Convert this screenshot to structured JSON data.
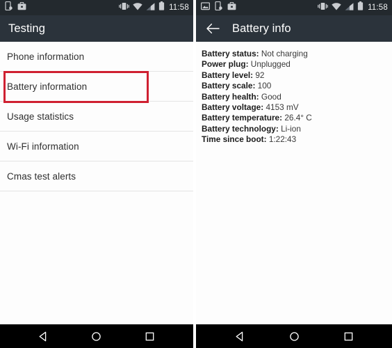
{
  "left_screen": {
    "statusbar": {
      "icons": [
        "usb-debug-icon",
        "work-briefcase-icon"
      ],
      "right_icons": [
        "vibrate-icon",
        "wifi-icon",
        "signal-icon",
        "battery-icon"
      ],
      "time": "11:58"
    },
    "toolbar": {
      "title": "Testing"
    },
    "list": {
      "items": [
        {
          "label": "Phone information"
        },
        {
          "label": "Battery information"
        },
        {
          "label": "Usage statistics"
        },
        {
          "label": "Wi-Fi information"
        },
        {
          "label": "Cmas test alerts"
        }
      ]
    },
    "highlight": {
      "target": "Battery information",
      "color": "#cf2031"
    }
  },
  "right_screen": {
    "statusbar": {
      "icons": [
        "screenshot-image-icon",
        "usb-debug-icon",
        "work-briefcase-icon"
      ],
      "right_icons": [
        "vibrate-icon",
        "wifi-icon",
        "signal-icon",
        "battery-icon"
      ],
      "time": "11:58"
    },
    "toolbar": {
      "back_icon": "arrow-left-icon",
      "title": "Battery info"
    },
    "info": {
      "rows": [
        {
          "label": "Battery status:",
          "value": "Not charging"
        },
        {
          "label": "Power plug:",
          "value": "Unplugged"
        },
        {
          "label": "Battery level:",
          "value": "92"
        },
        {
          "label": "Battery scale:",
          "value": "100"
        },
        {
          "label": "Battery health:",
          "value": "Good"
        },
        {
          "label": "Battery voltage:",
          "value": "4153 mV"
        },
        {
          "label": "Battery temperature:",
          "value": " 26.4° C"
        },
        {
          "label": "Battery technology:",
          "value": "Li-ion"
        },
        {
          "label": "Time since boot:",
          "value": "1:22:43"
        }
      ]
    }
  },
  "navbar": {
    "buttons": [
      {
        "name": "back-nav-button",
        "icon": "triangle-left-icon"
      },
      {
        "name": "home-nav-button",
        "icon": "circle-icon"
      },
      {
        "name": "recents-nav-button",
        "icon": "square-icon"
      }
    ]
  },
  "colors": {
    "toolbar": "#2b333b",
    "statusbar": "#23292e",
    "navbar": "#000000",
    "highlight": "#cf2031",
    "divider": "#e4e4e4"
  }
}
